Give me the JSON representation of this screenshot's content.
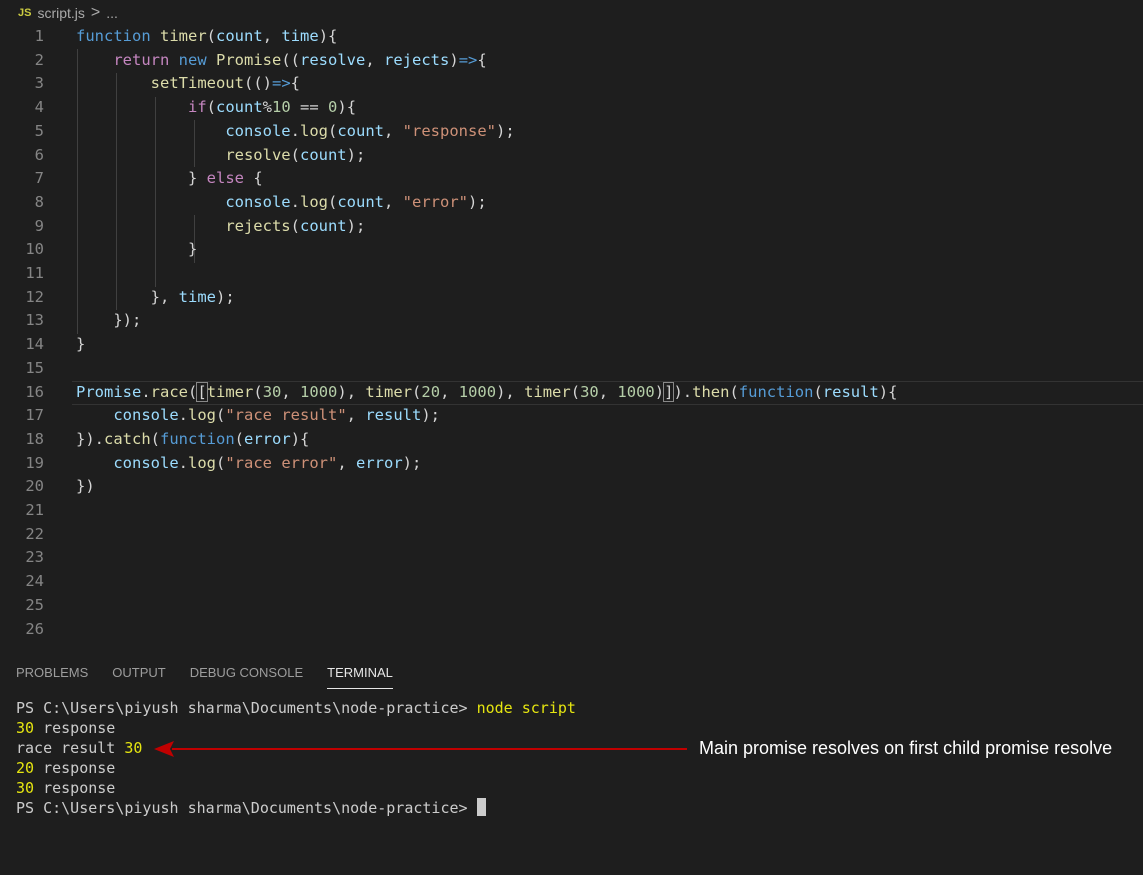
{
  "breadcrumb": {
    "badge": "JS",
    "file": "script.js",
    "sep": ">",
    "more": "..."
  },
  "editor": {
    "line_numbers": [
      "1",
      "2",
      "3",
      "4",
      "5",
      "6",
      "7",
      "8",
      "9",
      "10",
      "11",
      "12",
      "13",
      "14",
      "15",
      "16",
      "17",
      "18",
      "19",
      "20",
      "21",
      "22",
      "23",
      "24",
      "25",
      "26"
    ],
    "lines": [
      [
        [
          "k",
          "function"
        ],
        [
          "p",
          " "
        ],
        [
          "f",
          "timer"
        ],
        [
          "p",
          "("
        ],
        [
          "v",
          "count"
        ],
        [
          "p",
          ", "
        ],
        [
          "v",
          "time"
        ],
        [
          "p",
          "){"
        ]
      ],
      [
        [
          "p",
          "    "
        ],
        [
          "c",
          "return"
        ],
        [
          "p",
          " "
        ],
        [
          "k",
          "new"
        ],
        [
          "p",
          " "
        ],
        [
          "f",
          "Promise"
        ],
        [
          "p",
          "(("
        ],
        [
          "v",
          "resolve"
        ],
        [
          "p",
          ", "
        ],
        [
          "v",
          "rejects"
        ],
        [
          "p",
          ")"
        ],
        [
          "k",
          "=>"
        ],
        [
          "p",
          "{"
        ]
      ],
      [
        [
          "p",
          "        "
        ],
        [
          "f",
          "setTimeout"
        ],
        [
          "p",
          "(()"
        ],
        [
          "k",
          "=>"
        ],
        [
          "p",
          "{"
        ]
      ],
      [
        [
          "p",
          "            "
        ],
        [
          "c",
          "if"
        ],
        [
          "p",
          "("
        ],
        [
          "v",
          "count"
        ],
        [
          "p",
          "%"
        ],
        [
          "n",
          "10"
        ],
        [
          "p",
          " == "
        ],
        [
          "n",
          "0"
        ],
        [
          "p",
          "){"
        ]
      ],
      [
        [
          "p",
          "                "
        ],
        [
          "v",
          "console"
        ],
        [
          "p",
          "."
        ],
        [
          "f",
          "log"
        ],
        [
          "p",
          "("
        ],
        [
          "v",
          "count"
        ],
        [
          "p",
          ", "
        ],
        [
          "s",
          "\"response\""
        ],
        [
          "p",
          ");"
        ]
      ],
      [
        [
          "p",
          "                "
        ],
        [
          "f",
          "resolve"
        ],
        [
          "p",
          "("
        ],
        [
          "v",
          "count"
        ],
        [
          "p",
          ");"
        ]
      ],
      [
        [
          "p",
          "            } "
        ],
        [
          "c",
          "else"
        ],
        [
          "p",
          " {"
        ]
      ],
      [
        [
          "p",
          "                "
        ],
        [
          "v",
          "console"
        ],
        [
          "p",
          "."
        ],
        [
          "f",
          "log"
        ],
        [
          "p",
          "("
        ],
        [
          "v",
          "count"
        ],
        [
          "p",
          ", "
        ],
        [
          "s",
          "\"error\""
        ],
        [
          "p",
          ");"
        ]
      ],
      [
        [
          "p",
          "                "
        ],
        [
          "f",
          "rejects"
        ],
        [
          "p",
          "("
        ],
        [
          "v",
          "count"
        ],
        [
          "p",
          ");"
        ]
      ],
      [
        [
          "p",
          "            }"
        ]
      ],
      [
        [
          "p",
          ""
        ]
      ],
      [
        [
          "p",
          "        }, "
        ],
        [
          "v",
          "time"
        ],
        [
          "p",
          ");"
        ]
      ],
      [
        [
          "p",
          "    });"
        ]
      ],
      [
        [
          "p",
          "}"
        ]
      ],
      [
        [
          "p",
          ""
        ]
      ],
      [
        [
          "v",
          "Promise"
        ],
        [
          "p",
          "."
        ],
        [
          "f",
          "race"
        ],
        [
          "p",
          "("
        ],
        [
          "b",
          "["
        ],
        [
          "f",
          "timer"
        ],
        [
          "p",
          "("
        ],
        [
          "n",
          "30"
        ],
        [
          "p",
          ", "
        ],
        [
          "n",
          "1000"
        ],
        [
          "p",
          "), "
        ],
        [
          "f",
          "timer"
        ],
        [
          "p",
          "("
        ],
        [
          "n",
          "20"
        ],
        [
          "p",
          ", "
        ],
        [
          "n",
          "1000"
        ],
        [
          "p",
          "), "
        ],
        [
          "f",
          "timer"
        ],
        [
          "p",
          "("
        ],
        [
          "n",
          "30"
        ],
        [
          "p",
          ", "
        ],
        [
          "n",
          "1000"
        ],
        [
          "p",
          ")"
        ],
        [
          "b",
          "]"
        ],
        [
          "p",
          ")."
        ],
        [
          "f",
          "then"
        ],
        [
          "p",
          "("
        ],
        [
          "k",
          "function"
        ],
        [
          "p",
          "("
        ],
        [
          "v",
          "result"
        ],
        [
          "p",
          "){"
        ]
      ],
      [
        [
          "p",
          "    "
        ],
        [
          "v",
          "console"
        ],
        [
          "p",
          "."
        ],
        [
          "f",
          "log"
        ],
        [
          "p",
          "("
        ],
        [
          "s",
          "\"race result\""
        ],
        [
          "p",
          ", "
        ],
        [
          "v",
          "result"
        ],
        [
          "p",
          ");"
        ]
      ],
      [
        [
          "p",
          "})."
        ],
        [
          "f",
          "catch"
        ],
        [
          "p",
          "("
        ],
        [
          "k",
          "function"
        ],
        [
          "p",
          "("
        ],
        [
          "v",
          "error"
        ],
        [
          "p",
          "){"
        ]
      ],
      [
        [
          "p",
          "    "
        ],
        [
          "v",
          "console"
        ],
        [
          "p",
          "."
        ],
        [
          "f",
          "log"
        ],
        [
          "p",
          "("
        ],
        [
          "s",
          "\"race error\""
        ],
        [
          "p",
          ", "
        ],
        [
          "v",
          "error"
        ],
        [
          "p",
          ");"
        ]
      ],
      [
        [
          "p",
          "})"
        ]
      ],
      [
        [
          "p",
          ""
        ]
      ],
      [
        [
          "p",
          ""
        ]
      ],
      [
        [
          "p",
          ""
        ]
      ],
      [
        [
          "p",
          ""
        ]
      ],
      [
        [
          "p",
          ""
        ]
      ],
      [
        [
          "p",
          ""
        ]
      ]
    ]
  },
  "panel": {
    "tabs": [
      "PROBLEMS",
      "OUTPUT",
      "DEBUG CONSOLE",
      "TERMINAL"
    ],
    "active_tab": "TERMINAL"
  },
  "terminal": {
    "prompt": "PS C:\\Users\\piyush sharma\\Documents\\node-practice> ",
    "command": "node script",
    "outputs": [
      {
        "num": "30",
        "text": " response"
      },
      {
        "text": "race result ",
        "num": "30"
      },
      {
        "num": "20",
        "text": " response"
      },
      {
        "num": "30",
        "text": " response"
      }
    ],
    "final_prompt": "PS C:\\Users\\piyush sharma\\Documents\\node-practice> "
  },
  "annotation": {
    "text": "Main promise resolves on first child promise resolve",
    "color": "#c00000"
  }
}
